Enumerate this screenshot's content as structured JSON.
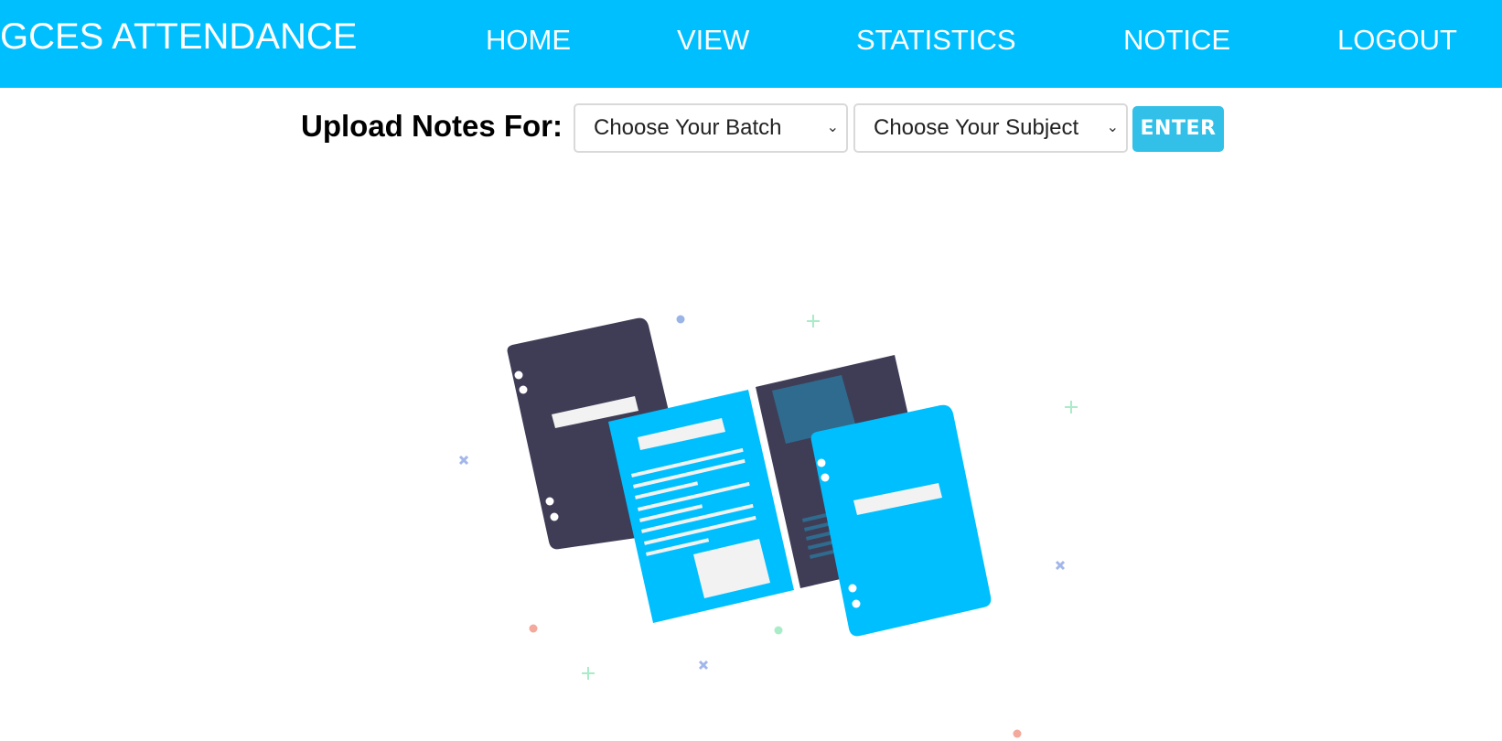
{
  "navbar": {
    "brand": "GCES ATTENDANCE",
    "links": [
      "HOME",
      "VIEW",
      "STATISTICS",
      "NOTICE",
      "LOGOUT"
    ]
  },
  "upload": {
    "label": "Upload Notes For:",
    "batch_select": {
      "selected": "Choose Your Batch"
    },
    "subject_select": {
      "selected": "Choose Your Subject"
    },
    "enter_label": "ENTER"
  },
  "colors": {
    "primary": "#00bfff",
    "dark_folder": "#3f3d56",
    "paper": "#f2f2f2"
  },
  "illustration": {
    "name": "documents-illustration"
  }
}
